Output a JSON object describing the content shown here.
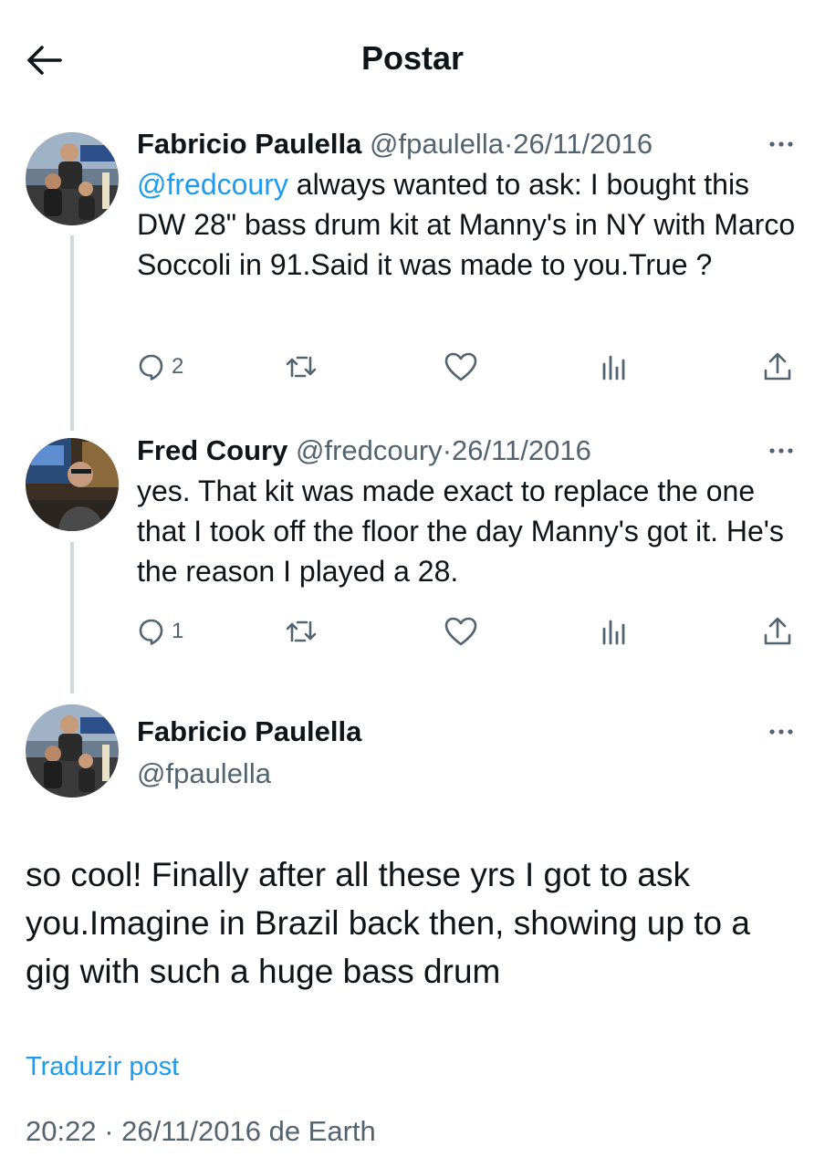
{
  "header": {
    "title": "Postar"
  },
  "tweets": [
    {
      "name": "Fabricio Paulella",
      "handle": "@fpaulella",
      "dot": "·",
      "date": "26/11/2016",
      "mention": "@fredcoury",
      "text": " always wanted to ask: I bought this DW 28\" bass drum kit at Manny's in NY with Marco Soccoli in 91.Said it was made to you.True ?",
      "replies": "2"
    },
    {
      "name": "Fred Coury",
      "handle": "@fredcoury",
      "dot": "·",
      "date": "26/11/2016",
      "text": "yes. That kit was made exact to replace the one that I took off the floor the day Manny's got it. He's the reason I played a 28.",
      "replies": "1"
    }
  ],
  "main": {
    "name": "Fabricio Paulella",
    "handle": "@fpaulella",
    "text": "so cool! Finally after all these yrs I got to ask you.Imagine in Brazil back then, showing up to a gig with such a huge bass drum",
    "translate": "Traduzir post",
    "footer": "20:22 · 26/11/2016 de Earth"
  },
  "icons": {
    "back": "arrow-left-icon",
    "more": "more-horizontal-icon",
    "reply": "reply-icon",
    "repost": "repost-icon",
    "like": "heart-icon",
    "views": "views-icon",
    "share": "share-icon"
  },
  "colors": {
    "accent": "#1d9bf0",
    "secondary": "#536471",
    "text": "#0f1419",
    "line": "#cfd9de"
  }
}
